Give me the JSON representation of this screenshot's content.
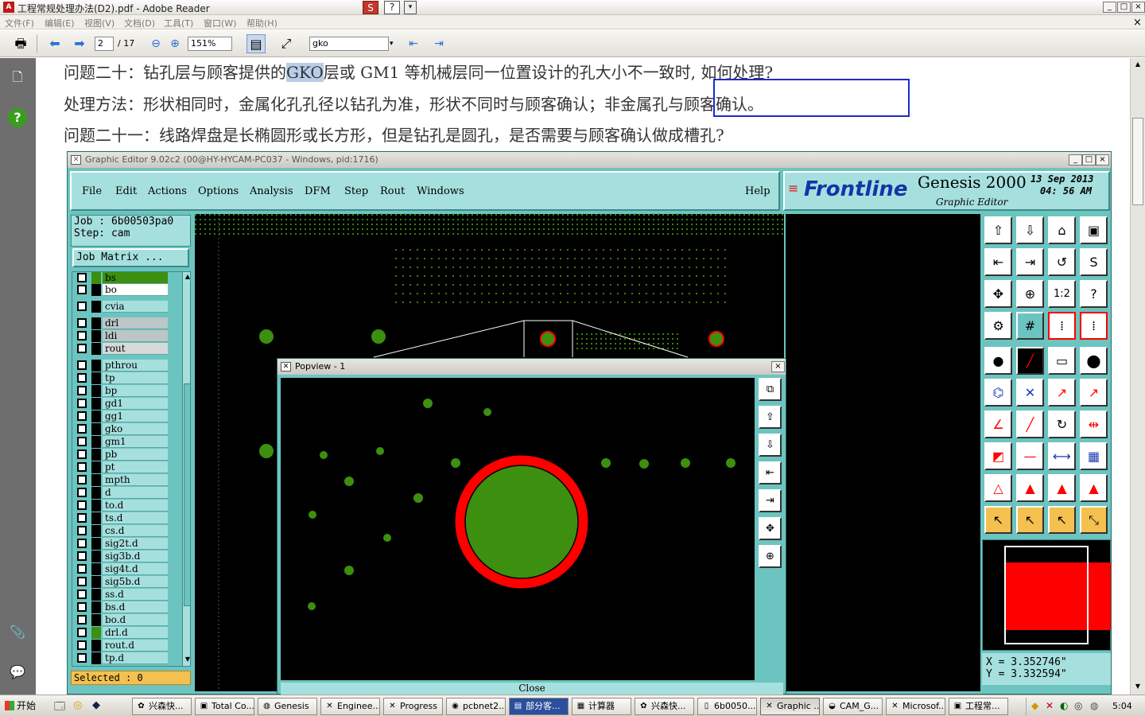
{
  "reader": {
    "title": "工程常规处理办法(D2).pdf - Adobe Reader",
    "app_icon_text": "A",
    "win_min": "_",
    "win_max": "□",
    "win_close": "×",
    "menu": [
      "文件(F)",
      "编辑(E)",
      "视图(V)",
      "文档(D)",
      "工具(T)",
      "窗口(W)",
      "帮助(H)"
    ],
    "page_current": "2",
    "page_total": "/ 17",
    "zoom": "151%",
    "search_value": "gko",
    "doc_close": "×"
  },
  "pdf": {
    "line1_a": "问题二十：钻孔层与顾客提供的",
    "line1_hl": "GKO",
    "line1_b": "层或 GM1 等机械层同一位置设计的孔大小不一致时, 如何处理?",
    "line2_a": "处理方法：形状相同时，金属化孔孔径以钻孔为准，形状不同时与顾客确认；",
    "line2_b": "非金属孔与顾客确认。",
    "line3": "问题二十一：线路焊盘是长椭圆形或长方形，但是钻孔是圆孔，是否需要与顾客确认做成槽孔?"
  },
  "genesis": {
    "title": "Graphic Editor 9.02c2 (00@HY-HYCAM-PC037 - Windows, pid:1716)",
    "menu": [
      "File",
      "Edit",
      "Actions",
      "Options",
      "Analysis",
      "DFM",
      "Step",
      "Rout",
      "Windows"
    ],
    "help": "Help",
    "brand_logo": "Frontline",
    "brand_product": "Genesis 2000",
    "brand_sub": "Graphic Editor",
    "date": "13  Sep  2013",
    "time": "04: 56  AM",
    "job": "Job  :  6b00503pa0",
    "step": "Step:  cam",
    "job_matrix": "Job Matrix ...",
    "layers": [
      "bs",
      "bo",
      "cvia",
      "drl",
      "ldi",
      "rout",
      "pthrou",
      "tp",
      "bp",
      "gd1",
      "gg1",
      "gko",
      "gm1",
      "pb",
      "pt",
      "mpth",
      "d",
      "to.d",
      "ts.d",
      "cs.d",
      "sig2t.d",
      "sig3b.d",
      "sig4t.d",
      "sig5b.d",
      "ss.d",
      "bs.d",
      "bo.d",
      "drl.d",
      "rout.d",
      "tp.d"
    ],
    "selected": "Selected : 0",
    "coord_x": "X  =  3.352746\"",
    "coord_y": "Y  =  3.332594\"",
    "colors": {
      "pad_green": "#3d8f0f",
      "highlight_red": "#ff0000",
      "panel_cyan": "#6cc4c0",
      "list_cyan": "#a6e0de",
      "selected_yellow": "#f4c050"
    }
  },
  "popview": {
    "title": "Popview - 1",
    "close_x": "×",
    "close_button": "Close"
  },
  "taskbar": {
    "start": "开始",
    "clock": "5:04",
    "tasks": [
      "兴森快...",
      "Total Co...",
      "Genesis",
      "Enginee...",
      "Progress",
      "pcbnet2...",
      "部分客...",
      "计算器",
      "兴森快...",
      "6b0050...",
      "Graphic ...",
      "CAM_G...",
      "Microsof...",
      "工程常..."
    ]
  }
}
